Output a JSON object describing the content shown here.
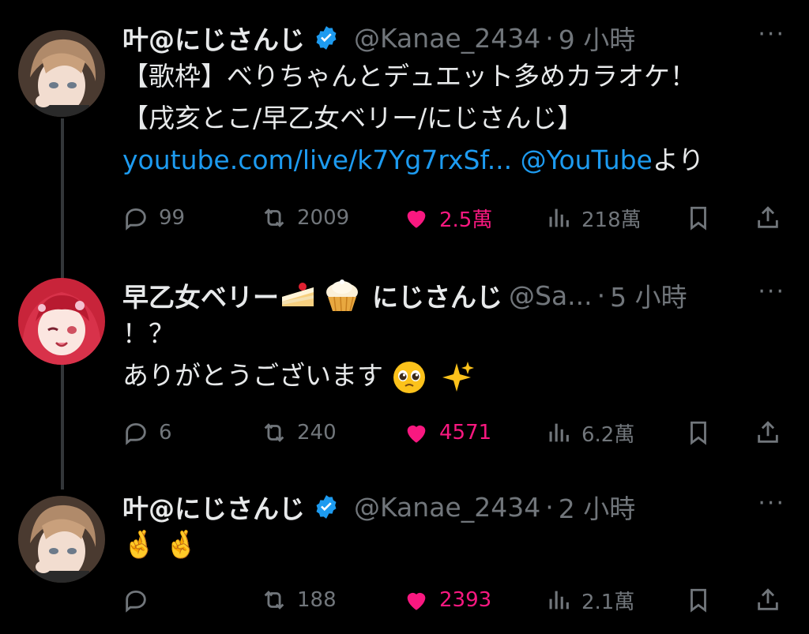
{
  "tweets": [
    {
      "name": "叶@にじさんじ",
      "handle": "@Kanae_2434",
      "dot": "·",
      "time": "9 小時",
      "text_line1": "【歌枠】べりちゃんとデュエット多めカラオケ！",
      "text_line2": "【戌亥とこ/早乙女ベリー/にじさんじ】",
      "link": "youtube.com/live/k7Yg7rxSf...",
      "mention": "@YouTube",
      "link_suffix": "より",
      "replies": "99",
      "retweets": "2009",
      "likes": "2.5萬",
      "views": "218萬",
      "verified": true
    },
    {
      "name": "早乙女ベリー",
      "name_suffix": "にじさんじ",
      "handle": "@Sa...",
      "dot": "·",
      "time": "5 小時",
      "text_line1": "！？",
      "text_line2": "ありがとうございます",
      "replies": "6",
      "retweets": "240",
      "likes": "4571",
      "views": "6.2萬"
    },
    {
      "name": "叶@にじさんじ",
      "handle": "@Kanae_2434",
      "dot": "·",
      "time": "2 小時",
      "text_line1": "🤞 🤞",
      "replies": "",
      "retweets": "188",
      "likes": "2393",
      "views": "2.1萬",
      "verified": true
    }
  ],
  "more_label": "···",
  "colors": {
    "accent": "#1d9bf0",
    "like": "#f91880",
    "muted": "#71767b",
    "text": "#e7e9ea",
    "bg": "#000000"
  },
  "icons": [
    "reply-icon",
    "retweet-icon",
    "heart-icon",
    "views-icon",
    "bookmark-icon",
    "share-icon",
    "verified-icon",
    "more-icon",
    "cake-icon",
    "cupcake-icon",
    "pleading-face-icon",
    "sparkles-icon"
  ]
}
